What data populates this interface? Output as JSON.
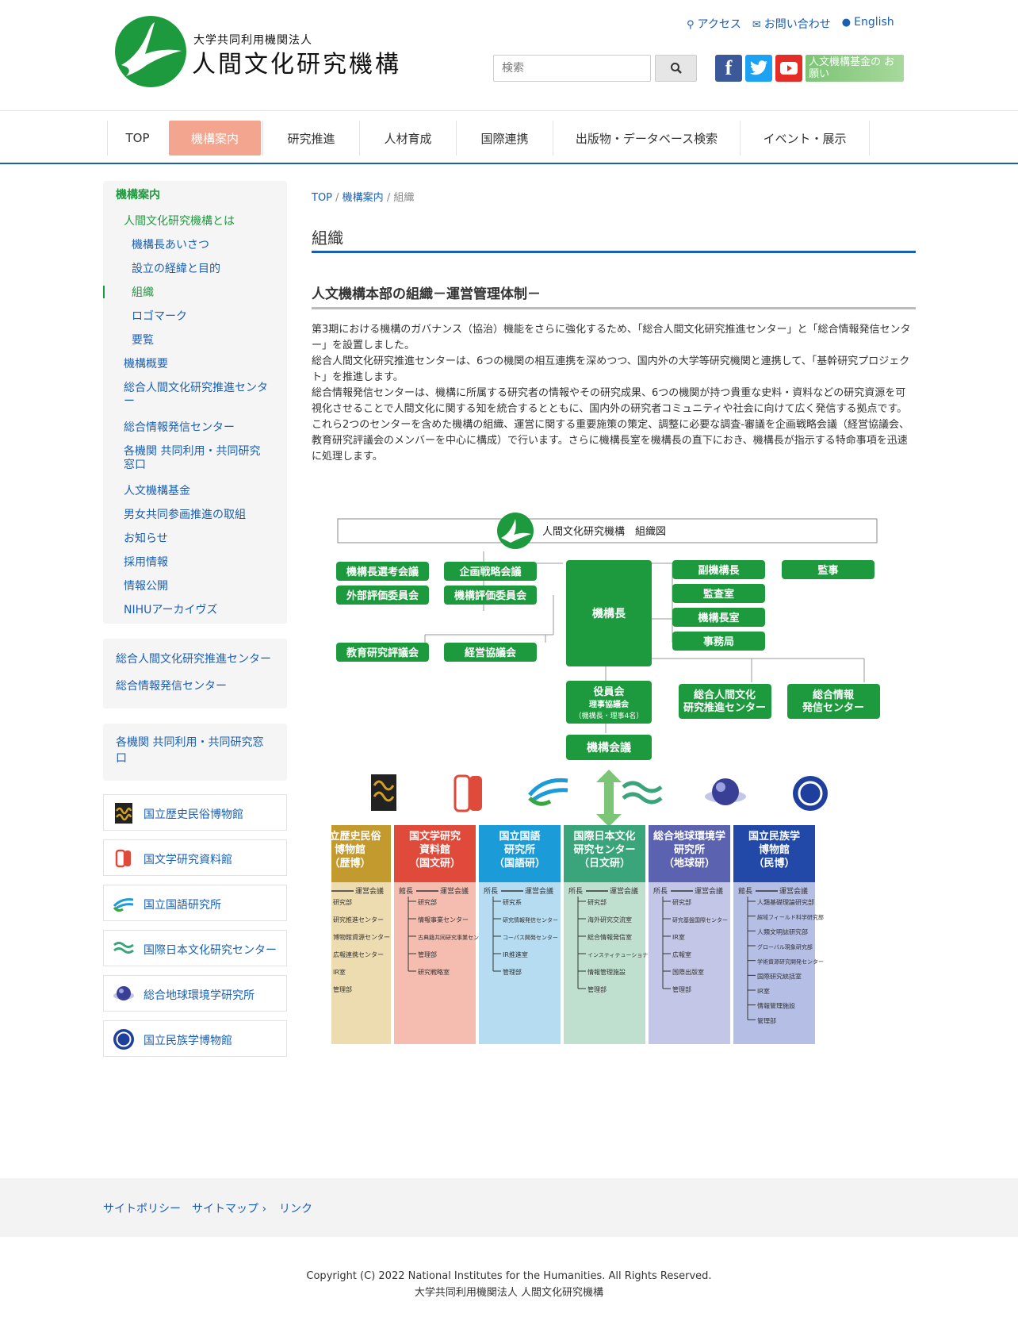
{
  "header": {
    "logo_sub": "大学共同利用機関法人",
    "logo_title": "人間文化研究機構",
    "links": [
      "アクセス",
      "お問い合わせ",
      "English"
    ],
    "search_placeholder": "検索",
    "fund_banner": "人文機構基金の お願い"
  },
  "nav": [
    "TOP",
    "機構案内",
    "研究推進",
    "人材育成",
    "国際連携",
    "出版物・データベース検索",
    "イベント・展示"
  ],
  "sidebar": {
    "heading": "機構案内",
    "items": [
      "人間文化研究機構とは",
      "機構長あいさつ",
      "設立の経緯と目的",
      "組織",
      "ロゴマーク",
      "要覧",
      "機構概要",
      "総合人間文化研究推進センター",
      "総合情報発信センター",
      "各機関 共同利用・共同研究窓口",
      "人文機構基金",
      "男女共同参画推進の取組",
      "お知らせ",
      "採用情報",
      "情報公開",
      "NIHUアーカイヴズ"
    ],
    "centers": [
      "総合人間文化研究推進センター",
      "総合情報発信センター"
    ],
    "joint": "各機関 共同利用・共同研究窓口",
    "institutes": [
      "国立歴史民俗博物館",
      "国文学研究資料館",
      "国立国語研究所",
      "国際日本文化研究センター",
      "総合地球環境学研究所",
      "国立民族学博物館"
    ]
  },
  "breadcrumb": [
    "TOP",
    "機構案内",
    "組織"
  ],
  "page_title": "組織",
  "section_title": "人文機構本部の組織－運営管理体制－",
  "paragraphs": [
    "第3期における機構のガバナンス（協治）機能をさらに強化するため、「総合人間文化研究推進センター」と「総合情報発信センター」を設置しました。",
    "総合人間文化研究推進センターは、6つの機関の相互連携を深めつつ、国内外の大学等研究機関と連携して、「基幹研究プロジェクト」を推進します。",
    "総合情報発信センターは、機構に所属する研究者の情報やその研究成果、6つの機関が持つ貴重な史料・資料などの研究資源を可視化させることで人間文化に関する知を統合するとともに、国内外の研究者コミュニティや社会に向けて広く発信する拠点です。",
    "これら2つのセンターを含めた機構の組織、運営に関する重要施策の策定、調整に必要な調査‐審議を企画戦略会議（経営協議会、教育研究評議会のメンバーを中心に構成）で行います。さらに機構長室を機構長の直下におき、機構長が指示する特命事項を迅速に処理します。"
  ],
  "org": {
    "title": "人間文化研究機構　組織図",
    "left_boxes": [
      "機構長選考会議",
      "企画戦略会議",
      "外部評価委員会",
      "機構評価委員会",
      "教育研究評議会",
      "経営協議会"
    ],
    "center": "機構長",
    "right_boxes": [
      "副機構長",
      "監査室",
      "機構長室",
      "事務局"
    ],
    "auditor": "監事",
    "officers": "役員会",
    "officers_sub": "理事協議会",
    "officers_sub2": "（機構長・理事4名）",
    "centers": [
      "総合人間文化 研究推進センター",
      "総合情報 発信センター"
    ],
    "council": "機構会議",
    "institutes": [
      {
        "name": [
          "国立歴史民俗",
          "博物館",
          "（歴博）"
        ],
        "color": "#c29a2e",
        "bg": "#ecdcb0",
        "head": "館長",
        "units": [
          "研究部",
          "研究推進センター",
          "博物館資源センター",
          "広報連携センター",
          "IR室",
          "管理部"
        ]
      },
      {
        "name": [
          "国文学研究",
          "資料館",
          "（国文研）"
        ],
        "color": "#e04a3a",
        "bg": "#f5bcb0",
        "head": "館長",
        "units": [
          "研究部",
          "情報事業センター",
          "古典籍共同研究事業センター",
          "管理部",
          "研究戦略室"
        ]
      },
      {
        "name": [
          "国立国語",
          "研究所",
          "（国語研）"
        ],
        "color": "#1b9cd8",
        "bg": "#b6dcf2",
        "head": "所長",
        "units": [
          "研究系",
          "研究情報発信センター",
          "コーパス開発センター",
          "IR推進室",
          "管理部"
        ]
      },
      {
        "name": [
          "国際日本文化",
          "研究センター",
          "（日文研）"
        ],
        "color": "#3aa57a",
        "bg": "#bfe0cf",
        "head": "所長",
        "units": [
          "研究部",
          "海外研究交流室",
          "総合情報発信室",
          "インスティテューショナル・リサーチ室",
          "情報管理施設",
          "管理部"
        ]
      },
      {
        "name": [
          "総合地球環境学",
          "研究所",
          "（地球研）"
        ],
        "color": "#5b62b0",
        "bg": "#c3c6e6",
        "head": "所長",
        "units": [
          "研究部",
          "研究基盤国際センター",
          "IR室",
          "広報室",
          "国際出版室",
          "管理部"
        ]
      },
      {
        "name": [
          "国立民族学",
          "博物館",
          "（民博）"
        ],
        "color": "#2248a8",
        "bg": "#b5bfe6",
        "head": "館長",
        "units": [
          "人類基礎理論研究部",
          "超域フィールド科学研究部",
          "人類文明誌研究部",
          "グローバル現象研究部",
          "学術資源研究開発センター",
          "国際研究統括室",
          "IR室",
          "情報管理施設",
          "管理部"
        ]
      }
    ],
    "committee": "運営会議"
  },
  "footer": {
    "links": [
      "サイトポリシー",
      "サイトマップ ›",
      "リンク"
    ],
    "copyright": "Copyright (C) 2022 National Institutes for the Humanities. All Rights Reserved.",
    "org": "大学共同利用機関法人 人間文化研究機構"
  },
  "colors": {
    "accent": "#1a5fb4",
    "green": "#1e9a3e",
    "nav_active": "#f4a58f"
  }
}
